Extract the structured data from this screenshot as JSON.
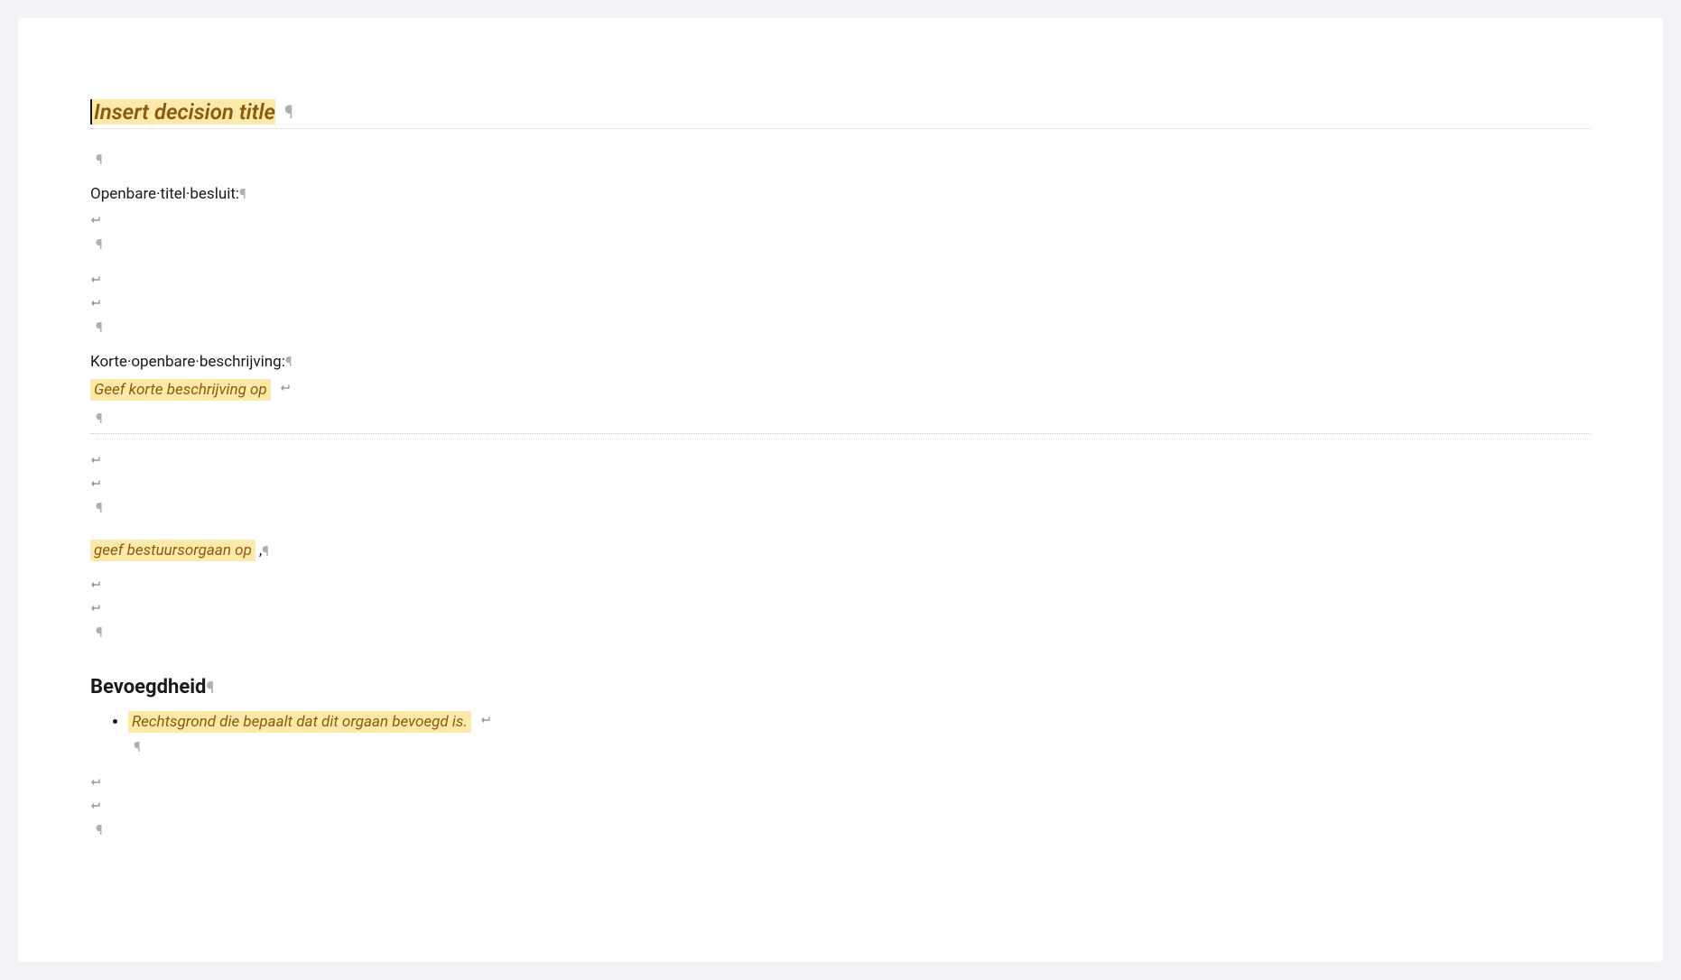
{
  "document": {
    "title_placeholder": "Insert decision title",
    "fields": {
      "public_title_label": "Openbare titel besluit:",
      "short_description_label": "Korte openbare beschrijving:",
      "short_description_placeholder": "Geef korte beschrijving op",
      "governing_body_placeholder": "geef bestuursorgaan op",
      "governing_body_suffix": ","
    },
    "sections": {
      "authority_heading": "Bevoegdheid",
      "authority_list": [
        "Rechtsgrond die bepaalt dat dit orgaan bevoegd is."
      ]
    },
    "marks": {
      "pilcrow": "¶",
      "middot": "·"
    }
  }
}
